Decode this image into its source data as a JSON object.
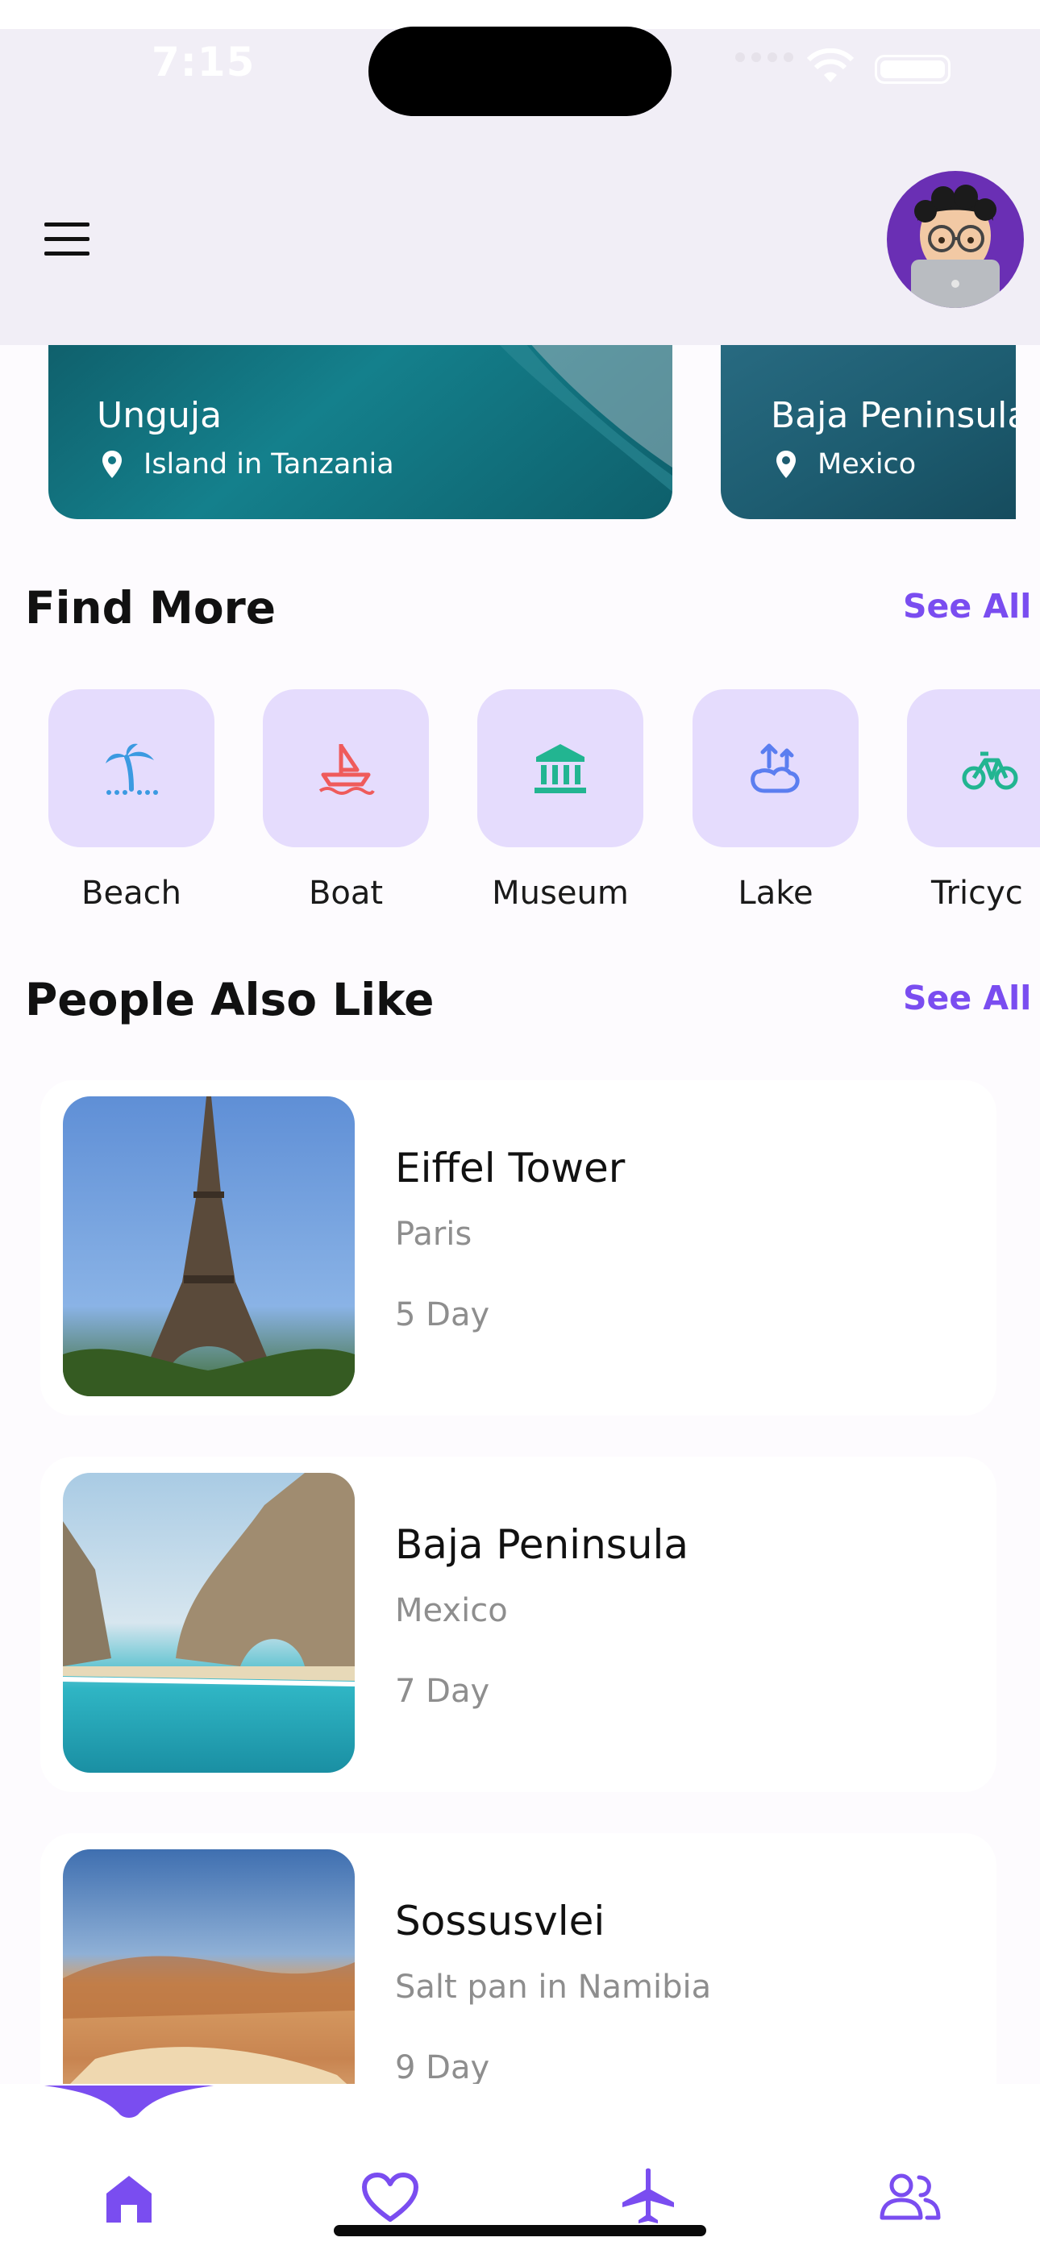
{
  "status_bar": {
    "time": "7:15"
  },
  "featured": [
    {
      "title": "Unguja",
      "location": "Island in Tanzania"
    },
    {
      "title": "Baja Peninsula",
      "location": "Mexico"
    }
  ],
  "find_more": {
    "title": "Find More",
    "see_all": "See All",
    "categories": [
      {
        "label": "Beach",
        "icon": "palm-tree-icon",
        "color": "#3b9ae1"
      },
      {
        "label": "Boat",
        "icon": "boat-icon",
        "color": "#ef5b5b"
      },
      {
        "label": "Museum",
        "icon": "museum-icon",
        "color": "#22b591"
      },
      {
        "label": "Lake",
        "icon": "lake-icon",
        "color": "#5b7ef0"
      },
      {
        "label": "Tricyc",
        "icon": "tricycle-icon",
        "color": "#22b591"
      }
    ]
  },
  "people_also_like": {
    "title": "People Also Like",
    "see_all": "See All",
    "items": [
      {
        "title": "Eiffel Tower",
        "subtitle": "Paris",
        "days": "5 Day"
      },
      {
        "title": "Baja Peninsula",
        "subtitle": "Mexico",
        "days": "7 Day"
      },
      {
        "title": "Sossusvlei",
        "subtitle": "Salt pan in Namibia",
        "days": "9 Day"
      }
    ]
  },
  "bottom_nav": {
    "items": [
      {
        "icon": "home-icon",
        "active": true
      },
      {
        "icon": "heart-icon",
        "active": false
      },
      {
        "icon": "airplane-icon",
        "active": false
      },
      {
        "icon": "people-icon",
        "active": false
      }
    ]
  },
  "colors": {
    "accent": "#7a4df0",
    "category_bg": "#e5dcfd",
    "header_bg": "#f1eef6"
  }
}
